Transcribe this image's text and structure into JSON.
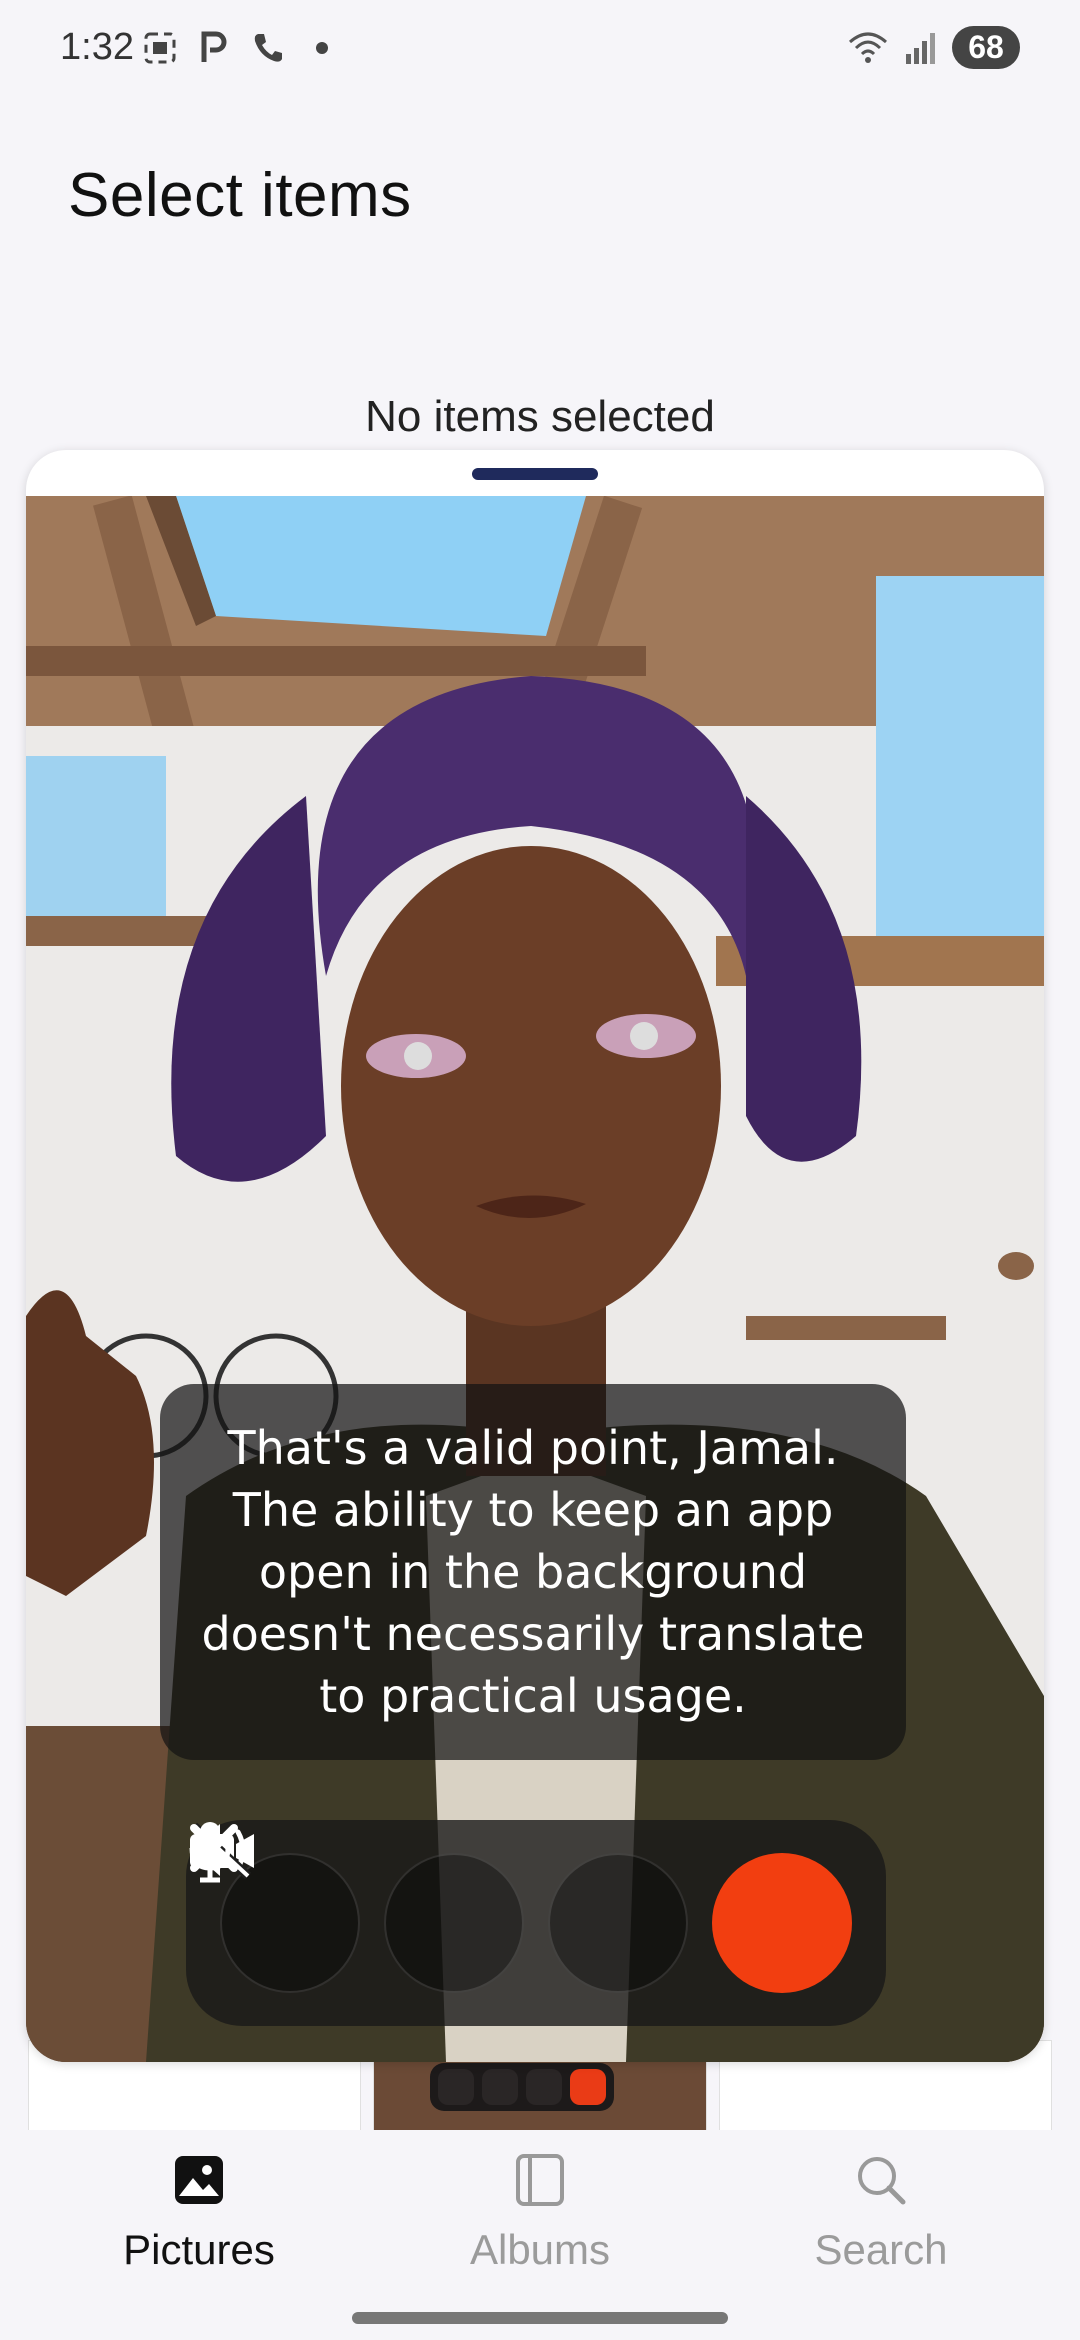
{
  "status_bar": {
    "time": "1:32",
    "battery": "68",
    "left_icons": [
      "screenshot-icon",
      "parking-icon",
      "phone-icon",
      "dot-icon"
    ],
    "right_icons": [
      "wifi-icon",
      "signal-icon"
    ]
  },
  "header": {
    "title": "Select items",
    "selection_status": "No items selected"
  },
  "call_sheet": {
    "caption": "That's a valid point, Jamal. The ability to keep an app open in the background doesn't necessarily translate to practical usage.",
    "controls": [
      {
        "name": "speaker",
        "icon": "speaker-icon"
      },
      {
        "name": "camera-off",
        "icon": "video-off-icon"
      },
      {
        "name": "microphone",
        "icon": "microphone-icon"
      },
      {
        "name": "end-call",
        "icon": "close-icon",
        "color": "#f23e10"
      }
    ]
  },
  "bottom_nav": {
    "items": [
      {
        "label": "Pictures",
        "icon": "image-icon",
        "active": true
      },
      {
        "label": "Albums",
        "icon": "album-icon",
        "active": false
      },
      {
        "label": "Search",
        "icon": "search-icon",
        "active": false
      }
    ]
  },
  "colors": {
    "end_call": "#f23e10",
    "sheet_handle": "#1f2a5c",
    "background": "#f6f5f9"
  }
}
